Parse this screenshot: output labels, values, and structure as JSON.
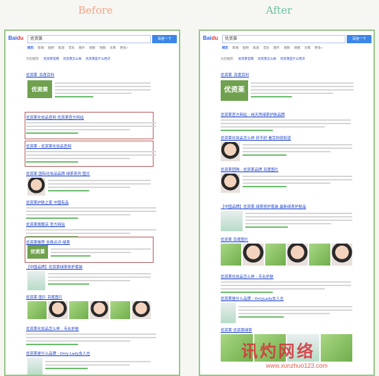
{
  "labels": {
    "before": "Before",
    "after": "After"
  },
  "baidu": {
    "logo_a": "Bai",
    "logo_b": "du",
    "logo_c": "百度"
  },
  "left": {
    "query": "优资莱",
    "search_button": "百度一下",
    "tabs": [
      "网页",
      "新闻",
      "贴吧",
      "知道",
      "音乐",
      "图片",
      "视频",
      "地图",
      "文库",
      "更多»"
    ],
    "related_label": "为您推荐:",
    "related": [
      "优资莱官网",
      "优资莱怎么样",
      "优资莱是什么档次"
    ],
    "results": [
      {
        "title": "优资莱_百度百科",
        "hl": "优资莱"
      },
      {
        "title": "优资莱化妆品官网 优资莱官方网站",
        "hl": "优资莱"
      },
      {
        "title": "优资莱 - 优资莱化妆品官网",
        "hl": "优资莱"
      },
      {
        "title": "优资莱 国际化妆品品牌 绿茶系列 图文",
        "hl": "优资莱"
      },
      {
        "title": "优资莱护肤之家 中国有品",
        "hl": "优资莱"
      },
      {
        "title": "优资莱旗舰店 官方网站",
        "hl": "优资莱"
      },
      {
        "title": "优资莱推荐 全面点评 绿茶",
        "hl": "优资莱"
      },
      {
        "title": "【中国品牌】优资莱绿茶修护套装",
        "hl": "优资莱"
      },
      {
        "title": "优资莱 图片 百度图片",
        "hl": "优资莱"
      },
      {
        "title": "优资莱化妆品怎么样 - 专业护肤",
        "hl": "优资莱"
      },
      {
        "title": "优资莱是什么品牌 - Only Lady女人志",
        "hl": "优资莱"
      }
    ]
  },
  "right": {
    "query": "优资莱",
    "search_button": "百度一下",
    "tabs": [
      "网页",
      "新闻",
      "贴吧",
      "知道",
      "音乐",
      "图片",
      "视频",
      "地图",
      "文库",
      "更多»"
    ],
    "related_label": "为您推荐:",
    "related": [
      "优资莱官网",
      "优资莱怎么样",
      "优资莱是什么档次"
    ],
    "results": [
      {
        "title": "优资莱_百度百科",
        "hl": "优资莱"
      },
      {
        "title": "优资莱官方网站 - 纯天然绿茶护肤品牌",
        "hl": "优资莱"
      },
      {
        "title": "优资莱化妆品怎么样 好不好 看完你就知道",
        "hl": "优资莱"
      },
      {
        "title": "优资莱团购 - 优资莱品牌 百度图片",
        "hl": "优资莱"
      },
      {
        "title": "【中国品牌】优资莱 绿茶修护套装 最新绿茶护肤品",
        "hl": "优资莱"
      },
      {
        "title": "优资莱 百度图片",
        "hl": "优资莱"
      },
      {
        "title": "优资莱化妆品怎么样 - 专业护肤",
        "hl": "优资莱"
      },
      {
        "title": "优资莱是什么品牌 - OnlyLady女人志",
        "hl": "优资莱"
      },
      {
        "title": "优资莱 优资莱绿茶",
        "hl": "优资莱"
      }
    ]
  },
  "image_text": {
    "brand_logo": "优资莱"
  },
  "watermark": {
    "text": "讯灼网络",
    "url": "www.xunzhuo123.com"
  }
}
